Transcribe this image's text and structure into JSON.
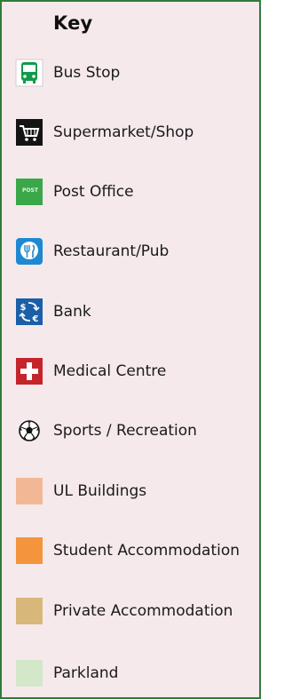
{
  "legend": {
    "title": "Key",
    "items": [
      {
        "label": "Bus Stop",
        "icon": "bus-icon",
        "color": "#0e9a4a"
      },
      {
        "label": "Supermarket/Shop",
        "icon": "shopping-cart-icon",
        "color": "#111111"
      },
      {
        "label": "Post Office",
        "icon": "post-office-icon",
        "color": "#3aa748",
        "icon_text": "POST"
      },
      {
        "label": "Restaurant/Pub",
        "icon": "restaurant-icon",
        "color": "#1e88d2"
      },
      {
        "label": "Bank",
        "icon": "bank-icon",
        "color": "#1a5fa8"
      },
      {
        "label": "Medical Centre",
        "icon": "medical-cross-icon",
        "color": "#c4252b"
      },
      {
        "label": "Sports / Recreation",
        "icon": "soccer-ball-icon",
        "color": "#111111"
      },
      {
        "label": "UL Buildings",
        "icon": "swatch",
        "color": "#f2b896"
      },
      {
        "label": "Student Accommodation",
        "icon": "swatch",
        "color": "#f4943c"
      },
      {
        "label": "Private Accommodation",
        "icon": "swatch",
        "color": "#d8b87a"
      },
      {
        "label": "Parkland",
        "icon": "swatch",
        "color": "#d3e8c8"
      }
    ]
  }
}
